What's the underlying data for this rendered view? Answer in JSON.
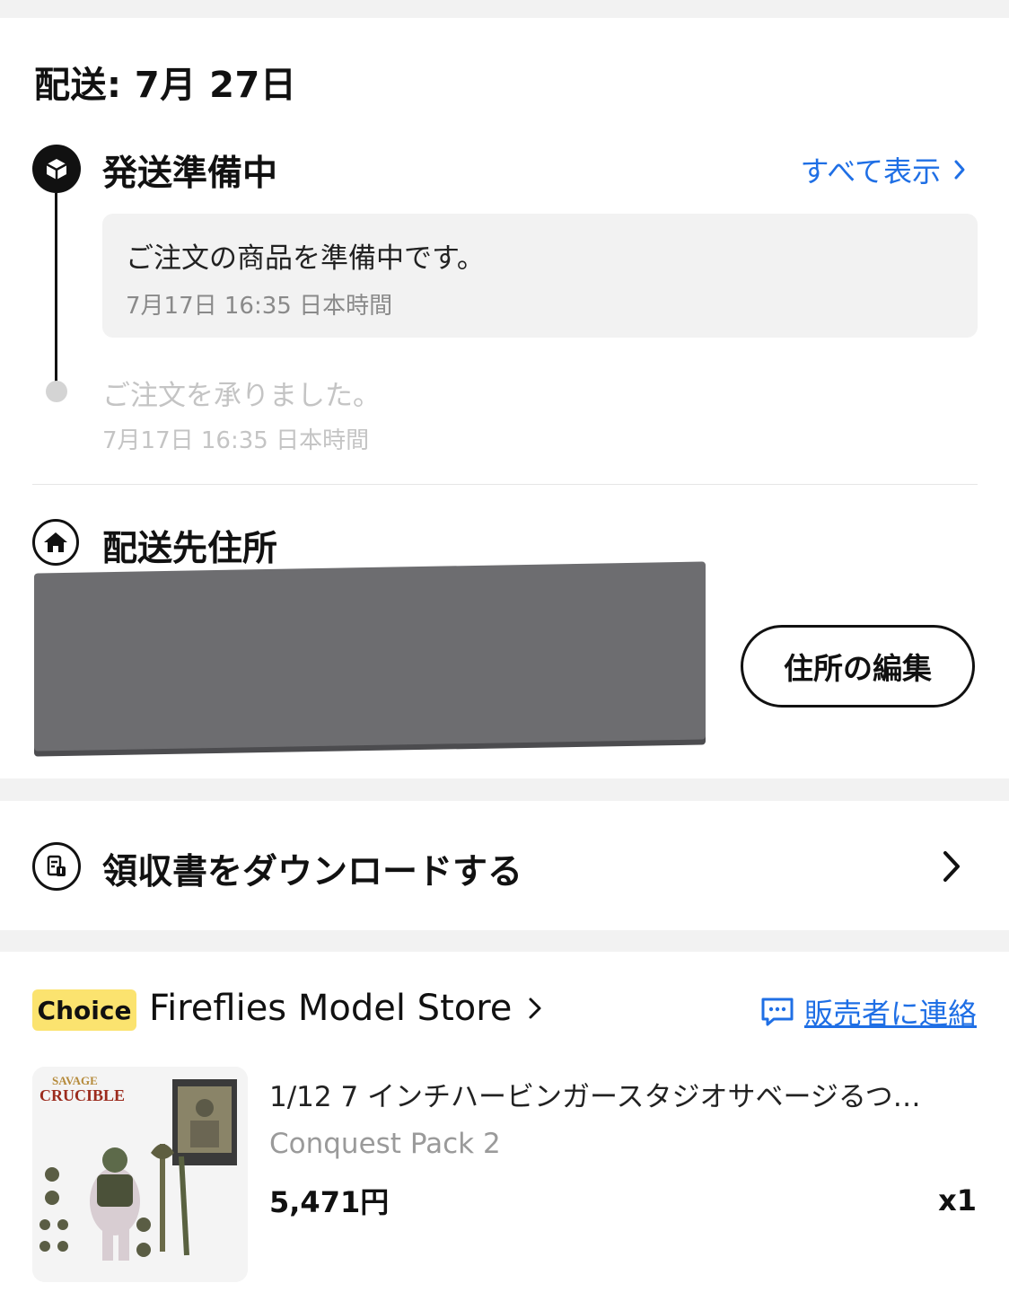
{
  "delivery": {
    "date_label": "配送: 7月 27日",
    "current_step": {
      "title": "発送準備中",
      "show_all": "すべて表示",
      "message": "ご注文の商品を準備中です。",
      "time": "7月17日 16:35 日本時間"
    },
    "past_step": {
      "message": "ご注文を承りました。",
      "time": "7月17日 16:35 日本時間"
    }
  },
  "address": {
    "title": "配送先住所",
    "edit_label": "住所の編集"
  },
  "receipt": {
    "label": "領収書をダウンロードする"
  },
  "store": {
    "badge": "Choice",
    "name": "Fireflies Model Store",
    "contact_label": "販売者に連絡",
    "product": {
      "title": "1/12 7 インチハービンガースタジオサベージるつ…",
      "variant": "Conquest Pack 2",
      "price": "5,471円",
      "quantity": "x1",
      "image_brand_top": "SAVAGE",
      "image_brand_bottom": "CRUCIBLE"
    }
  },
  "colors": {
    "link_blue": "#1f6fe5",
    "badge_yellow": "#fbe36f",
    "redaction_gray": "#6d6d70"
  },
  "icons": {
    "step": "package-icon",
    "address": "home-icon",
    "receipt": "receipt-icon",
    "contact": "chat-icon",
    "chevron": "chevron-right-icon"
  }
}
